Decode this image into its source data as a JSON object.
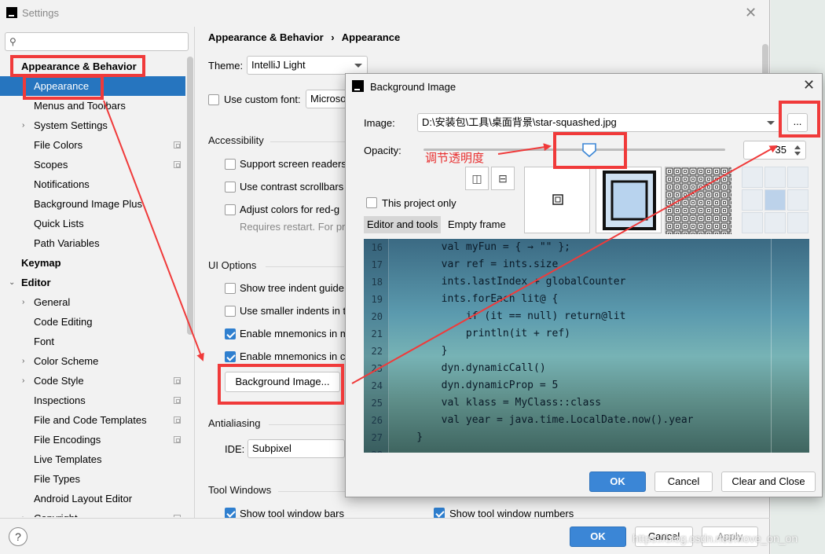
{
  "window": {
    "title": "Settings"
  },
  "sidebar": {
    "search_placeholder": "",
    "items": [
      {
        "label": "Appearance & Behavior",
        "level": 0,
        "bold": true
      },
      {
        "label": "Appearance",
        "level": 1,
        "selected": true
      },
      {
        "label": "Menus and Toolbars",
        "level": 1
      },
      {
        "label": "System Settings",
        "level": 1,
        "expandable": true
      },
      {
        "label": "File Colors",
        "level": 1,
        "project": true
      },
      {
        "label": "Scopes",
        "level": 1,
        "project": true
      },
      {
        "label": "Notifications",
        "level": 1
      },
      {
        "label": "Background Image Plus",
        "level": 1
      },
      {
        "label": "Quick Lists",
        "level": 1
      },
      {
        "label": "Path Variables",
        "level": 1
      },
      {
        "label": "Keymap",
        "level": 0,
        "bold": true
      },
      {
        "label": "Editor",
        "level": 0,
        "bold": true,
        "expandable": true
      },
      {
        "label": "General",
        "level": 1,
        "expandable": true
      },
      {
        "label": "Code Editing",
        "level": 1
      },
      {
        "label": "Font",
        "level": 1
      },
      {
        "label": "Color Scheme",
        "level": 1,
        "expandable": true
      },
      {
        "label": "Code Style",
        "level": 1,
        "expandable": true,
        "project": true
      },
      {
        "label": "Inspections",
        "level": 1,
        "project": true
      },
      {
        "label": "File and Code Templates",
        "level": 1,
        "project": true
      },
      {
        "label": "File Encodings",
        "level": 1,
        "project": true
      },
      {
        "label": "Live Templates",
        "level": 1
      },
      {
        "label": "File Types",
        "level": 1
      },
      {
        "label": "Android Layout Editor",
        "level": 1
      },
      {
        "label": "Copyright",
        "level": 1,
        "expandable": true,
        "project": true
      }
    ]
  },
  "content": {
    "breadcrumb": [
      "Appearance & Behavior",
      "Appearance"
    ],
    "breadcrumb_sep": "›",
    "theme_label": "Theme:",
    "theme_value": "IntelliJ Light",
    "custom_font_label": "Use custom font:",
    "custom_font_value": "Microso",
    "accessibility_title": "Accessibility",
    "acc_options": [
      "Support screen readers",
      "Use contrast scrollbars",
      "Adjust colors for red-g"
    ],
    "requires_restart": "Requires restart. For pr",
    "ui_options_title": "UI Options",
    "ui_options": [
      {
        "label": "Show tree indent guide",
        "checked": false
      },
      {
        "label": "Use smaller indents in t",
        "checked": false
      },
      {
        "label": "Enable mnemonics in m",
        "checked": true
      },
      {
        "label": "Enable mnemonics in c",
        "checked": true
      }
    ],
    "background_button": "Background Image...",
    "antialiasing_title": "Antialiasing",
    "ide_label": "IDE:",
    "ide_value": "Subpixel",
    "tool_windows_title": "Tool Windows",
    "tw_bars": "Show tool window bars",
    "tw_numbers": "Show tool window numbers"
  },
  "footer": {
    "help": "?",
    "ok": "OK",
    "cancel": "Cancel",
    "apply": "Apply",
    "watermark": "https://blog.csdn.net/move_on_on"
  },
  "dialog": {
    "title": "Background Image",
    "image_label": "Image:",
    "image_path": "D:\\安装包\\工具\\桌面背景\\star-squashed.jpg",
    "browse": "...",
    "opacity_label": "Opacity:",
    "opacity_value": "35",
    "opacity_level": 0.55,
    "flip_h_icon": "flip-horizontal-icon",
    "flip_v_icon": "flip-vertical-icon",
    "this_project_only": "This project only",
    "tabs": [
      "Editor and tools",
      "Empty frame"
    ],
    "annotation": "调节透明度",
    "ok": "OK",
    "cancel": "Cancel",
    "clear_close": "Clear and Close",
    "code": [
      {
        "ln": "16",
        "text": "        val myFun = { → \"\" };"
      },
      {
        "ln": "17",
        "text": "        var ref = ints.size"
      },
      {
        "ln": "18",
        "text": "        ints.lastIndex + globalCounter"
      },
      {
        "ln": "19",
        "text": "        ints.forEach lit@ {"
      },
      {
        "ln": "20",
        "text": "            if (it == null) return@lit"
      },
      {
        "ln": "21",
        "text": "            println(it + ref)"
      },
      {
        "ln": "22",
        "text": "        }"
      },
      {
        "ln": "23",
        "text": "        dyn.dynamicCall()"
      },
      {
        "ln": "24",
        "text": "        dyn.dynamicProp = 5"
      },
      {
        "ln": "25",
        "text": "        val klass = MyClass::class"
      },
      {
        "ln": "26",
        "text": "        val year = java.time.LocalDate.now().year"
      },
      {
        "ln": "27",
        "text": "    }"
      },
      {
        "ln": "28",
        "text": ""
      }
    ]
  },
  "colors": {
    "accent": "#2675bf",
    "annotation": "#f03a3a"
  }
}
